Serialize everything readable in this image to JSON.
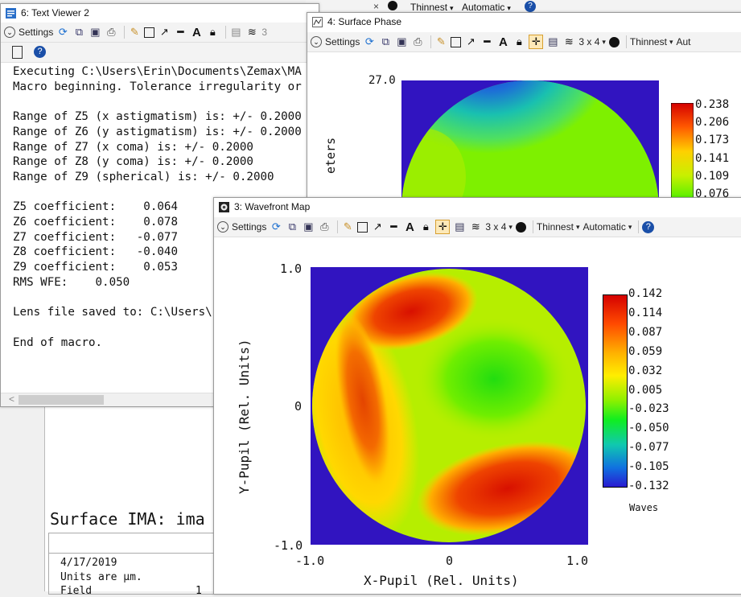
{
  "topstrip": {
    "thinnest": "Thinnest",
    "automatic": "Automatic",
    "close_glyph": "×"
  },
  "text_viewer": {
    "title": "6: Text Viewer 2",
    "settings": "Settings",
    "layout_label": "3",
    "lines": [
      "Executing C:\\Users\\Erin\\Documents\\Zemax\\MA",
      "Macro beginning. Tolerance irregularity or",
      "",
      "Range of Z5 (x astigmatism) is: +/- 0.2000",
      "Range of Z6 (y astigmatism) is: +/- 0.2000",
      "Range of Z7 (x coma) is: +/- 0.2000",
      "Range of Z8 (y coma) is: +/- 0.2000",
      "Range of Z9 (spherical) is: +/- 0.2000",
      "",
      "Z5 coefficient:    0.064",
      "Z6 coefficient:    0.078",
      "Z7 coefficient:   -0.077",
      "Z8 coefficient:   -0.040",
      "Z9 coefficient:    0.053",
      "RMS WFE:    0.050",
      "",
      "Lens file saved to: C:\\Users\\",
      "",
      "End of macro."
    ],
    "scroll_left": "<"
  },
  "background_report": {
    "heading": "Surface IMA: ima",
    "date": "4/17/2019",
    "units": "Units are µm.",
    "field_partial": "Field",
    "field_value": "1"
  },
  "surface_phase": {
    "title": "4: Surface Phase",
    "settings": "Settings",
    "layout": "3 x 4",
    "thinnest": "Thinnest",
    "automatic_partial": "Aut",
    "y_max": "27.0",
    "ylabel_partial": "eters",
    "colorbar": [
      "0.238",
      "0.206",
      "0.173",
      "0.141",
      "0.109",
      "0.076"
    ]
  },
  "wavefront": {
    "title": "3: Wavefront Map",
    "settings": "Settings",
    "layout": "3 x 4",
    "thinnest": "Thinnest",
    "automatic": "Automatic",
    "y_ticks": [
      "1.0",
      "0",
      "-1.0"
    ],
    "x_ticks": [
      "-1.0",
      "0",
      "1.0"
    ],
    "xlabel": "X-Pupil (Rel. Units)",
    "ylabel": "Y-Pupil (Rel. Units)",
    "colorbar": [
      "0.142",
      "0.114",
      "0.087",
      "0.059",
      "0.032",
      "0.005",
      "-0.023",
      "-0.050",
      "-0.077",
      "-0.105",
      "-0.132"
    ],
    "colorbar_unit": "Waves"
  },
  "colors": {
    "plot_bg": "#3114c0",
    "cmap_low": "#2a1ad0",
    "cmap_high": "#d40000"
  }
}
